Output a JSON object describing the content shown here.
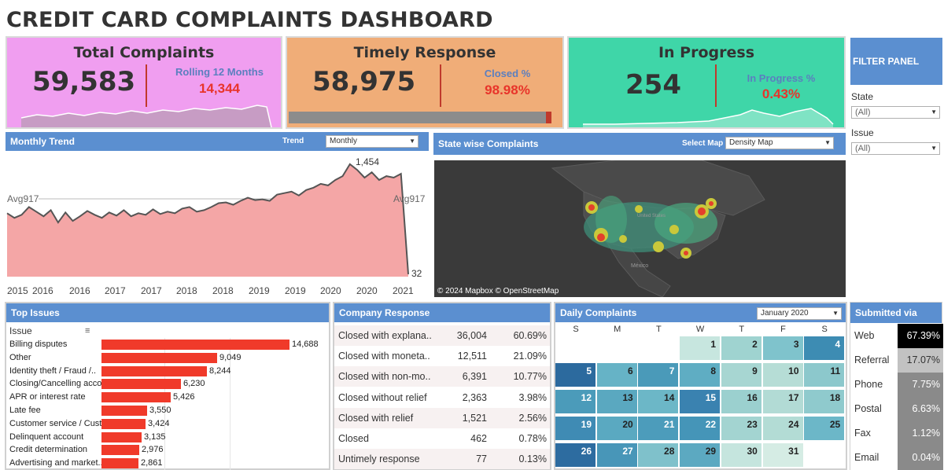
{
  "title": "CREDIT CARD COMPLAINTS DASHBOARD",
  "kpis": {
    "total": {
      "title": "Total Complaints",
      "value": "59,583",
      "sub_label": "Rolling 12 Months",
      "sub_value": "14,344",
      "bg": "#f09ef0"
    },
    "timely": {
      "title": "Timely Response",
      "value": "58,975",
      "sub_label": "Closed %",
      "sub_value": "98.98%",
      "bg": "#f0ad78",
      "progress": 0.9898
    },
    "progress": {
      "title": "In Progress",
      "value": "254",
      "sub_label": "In Progress %",
      "sub_value": "0.43%",
      "bg": "#3fd6a8"
    }
  },
  "filter_panel": {
    "title": "FILTER PANEL",
    "state_label": "State",
    "state_value": "(All)",
    "issue_label": "Issue",
    "issue_value": "(All)"
  },
  "monthly_trend": {
    "title": "Monthly Trend",
    "trend_label": "Trend",
    "trend_value": "Monthly",
    "avg_left": "Avg917",
    "avg_right": "Avg917",
    "max_label": "1,454",
    "min_label": "32",
    "x_ticks": [
      "2015",
      "2016",
      "2016",
      "2017",
      "2017",
      "2018",
      "2018",
      "2019",
      "2019",
      "2020",
      "2020",
      "2021"
    ]
  },
  "chart_data": {
    "type": "area",
    "title": "Monthly Trend",
    "y_avg": 917,
    "ylim": [
      0,
      1500
    ],
    "values": [
      820,
      760,
      800,
      900,
      840,
      780,
      860,
      700,
      830,
      720,
      780,
      850,
      800,
      760,
      830,
      790,
      860,
      780,
      820,
      800,
      870,
      810,
      840,
      820,
      880,
      900,
      840,
      860,
      900,
      950,
      960,
      930,
      980,
      1020,
      990,
      1000,
      980,
      1060,
      1080,
      1100,
      1050,
      1120,
      1150,
      1200,
      1180,
      1250,
      1300,
      1454,
      1380,
      1280,
      1350,
      1250,
      1300,
      1280,
      1330,
      32
    ]
  },
  "map": {
    "title": "State wise Complaints",
    "select_label": "Select Map",
    "select_value": "Density Map",
    "credit": "© 2024 Mapbox © OpenStreetMap",
    "labels": [
      "United States",
      "México"
    ]
  },
  "top_issues": {
    "title": "Top Issues",
    "col_header": "Issue",
    "max": 14688,
    "rows": [
      {
        "label": "Billing disputes",
        "value": 14688,
        "text": "14,688"
      },
      {
        "label": "Other",
        "value": 9049,
        "text": "9,049"
      },
      {
        "label": "Identity theft / Fraud /..",
        "value": 8244,
        "text": "8,244"
      },
      {
        "label": "Closing/Cancelling acco..",
        "value": 6230,
        "text": "6,230"
      },
      {
        "label": "APR or interest rate",
        "value": 5426,
        "text": "5,426"
      },
      {
        "label": "Late fee",
        "value": 3550,
        "text": "3,550"
      },
      {
        "label": "Customer service / Cust..",
        "value": 3424,
        "text": "3,424"
      },
      {
        "label": "Delinquent account",
        "value": 3135,
        "text": "3,135"
      },
      {
        "label": "Credit determination",
        "value": 2976,
        "text": "2,976"
      },
      {
        "label": "Advertising and market..",
        "value": 2861,
        "text": "2,861"
      }
    ]
  },
  "company_response": {
    "title": "Company Response",
    "rows": [
      {
        "label": "Closed with explana..",
        "count": "36,004",
        "pct": "60.69%"
      },
      {
        "label": "Closed with moneta..",
        "count": "12,511",
        "pct": "21.09%"
      },
      {
        "label": "Closed with non-mo..",
        "count": "6,391",
        "pct": "10.77%"
      },
      {
        "label": "Closed without relief",
        "count": "2,363",
        "pct": "3.98%"
      },
      {
        "label": "Closed with relief",
        "count": "1,521",
        "pct": "2.56%"
      },
      {
        "label": "Closed",
        "count": "462",
        "pct": "0.78%"
      },
      {
        "label": "Untimely response",
        "count": "77",
        "pct": "0.13%"
      }
    ]
  },
  "daily": {
    "title": "Daily Complaints",
    "month_value": "January 2020",
    "weekdays": [
      "S",
      "M",
      "T",
      "W",
      "T",
      "F",
      "S"
    ],
    "start_offset": 3,
    "days": [
      {
        "d": "1",
        "c": "#c7e6df"
      },
      {
        "d": "2",
        "c": "#9fd3d0"
      },
      {
        "d": "3",
        "c": "#7fc3cc"
      },
      {
        "d": "4",
        "c": "#3d8cb3"
      },
      {
        "d": "5",
        "c": "#2c6a9e"
      },
      {
        "d": "6",
        "c": "#66b3c6"
      },
      {
        "d": "7",
        "c": "#4a9ab9"
      },
      {
        "d": "8",
        "c": "#5fadc3"
      },
      {
        "d": "9",
        "c": "#a7d6d2"
      },
      {
        "d": "10",
        "c": "#b6ddd6"
      },
      {
        "d": "11",
        "c": "#8cc8cc"
      },
      {
        "d": "12",
        "c": "#4b9bba"
      },
      {
        "d": "13",
        "c": "#5aa8c0"
      },
      {
        "d": "14",
        "c": "#6cb7c7"
      },
      {
        "d": "15",
        "c": "#3a82b0"
      },
      {
        "d": "16",
        "c": "#9bd0cf"
      },
      {
        "d": "17",
        "c": "#b2dbd5"
      },
      {
        "d": "18",
        "c": "#8fcacd"
      },
      {
        "d": "19",
        "c": "#3f8bb4"
      },
      {
        "d": "20",
        "c": "#5aa9c1"
      },
      {
        "d": "21",
        "c": "#4c9cbb"
      },
      {
        "d": "22",
        "c": "#4595b8"
      },
      {
        "d": "23",
        "c": "#a3d4d1"
      },
      {
        "d": "24",
        "c": "#b3dcd5"
      },
      {
        "d": "25",
        "c": "#6cb7c8"
      },
      {
        "d": "26",
        "c": "#2d6ca0"
      },
      {
        "d": "27",
        "c": "#4896b8"
      },
      {
        "d": "28",
        "c": "#7fc1cb"
      },
      {
        "d": "29",
        "c": "#5ca9c1"
      },
      {
        "d": "30",
        "c": "#c5e5de"
      },
      {
        "d": "31",
        "c": "#d5ece4"
      }
    ]
  },
  "submitted": {
    "title": "Submitted via",
    "rows": [
      {
        "label": "Web",
        "pct": "67.39%",
        "bg": "#000000",
        "fg": "#ffffff"
      },
      {
        "label": "Referral",
        "pct": "17.07%",
        "bg": "#c2c2c2",
        "fg": "#333333"
      },
      {
        "label": "Phone",
        "pct": "7.75%",
        "bg": "#8a8a8a",
        "fg": "#ffffff"
      },
      {
        "label": "Postal m..",
        "pct": "6.63%",
        "bg": "#8a8a8a",
        "fg": "#ffffff"
      },
      {
        "label": "Fax",
        "pct": "1.12%",
        "bg": "#8a8a8a",
        "fg": "#ffffff"
      },
      {
        "label": "Email",
        "pct": "0.04%",
        "bg": "#8a8a8a",
        "fg": "#ffffff"
      }
    ]
  }
}
